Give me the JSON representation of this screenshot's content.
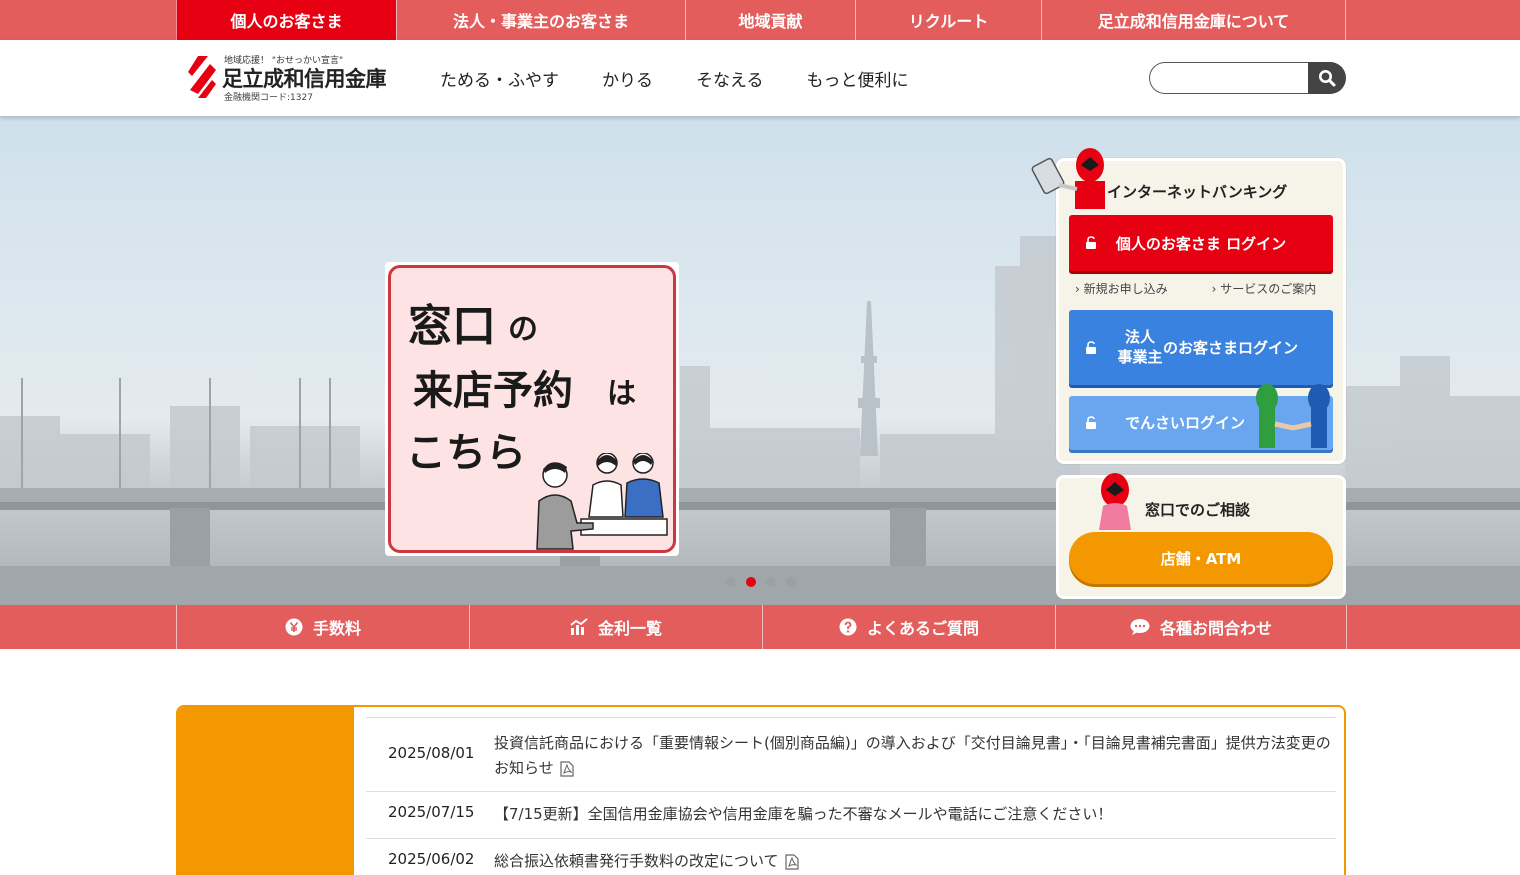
{
  "top_nav": {
    "items": [
      {
        "label": "個人のお客さま",
        "active": true
      },
      {
        "label": "法人・事業主のお客さま",
        "active": false
      },
      {
        "label": "地域貢献",
        "active": false
      },
      {
        "label": "リクルート",
        "active": false
      },
      {
        "label": "足立成和信用金庫について",
        "active": false
      }
    ]
  },
  "header": {
    "logo_tagline": "地域応援！ \"おせっかい宣言\"",
    "logo_name": "足立成和信用金庫",
    "logo_code": "金融機関コード:1327",
    "nav": [
      "ためる・ふやす",
      "かりる",
      "そなえる",
      "もっと便利に"
    ],
    "search": {
      "placeholder": "",
      "value": "",
      "icon": "search-icon"
    }
  },
  "hero": {
    "banner": {
      "line1_big": "窓口",
      "line1_small": "の",
      "line2_big": "来店予約",
      "line2_small": "は",
      "line3": "こちら"
    },
    "slides_total": 4,
    "active_slide": 2
  },
  "internet_banking": {
    "title": "インターネットバンキング",
    "personal_login": "個人のお客さま ログイン",
    "links": [
      "新規お申し込み",
      "サービスのご案内"
    ],
    "corporate_line1": "法人",
    "corporate_line2": "事業主",
    "corporate_suffix": "のお客さまログイン",
    "densai_login": "でんさいログイン"
  },
  "consult": {
    "title": "窓口でのご相談",
    "button": "店舗・ATM"
  },
  "quick_links": [
    {
      "label": "手数料",
      "icon": "yen-icon"
    },
    {
      "label": "金利一覧",
      "icon": "chart-icon"
    },
    {
      "label": "よくあるご質問",
      "icon": "question-icon"
    },
    {
      "label": "各種お問合わせ",
      "icon": "chat-icon"
    }
  ],
  "news": [
    {
      "date": "2025/08/01",
      "title": "投資信託商品における「重要情報シート(個別商品編)」の導入および「交付目論見書」・「目論見書補完書面」提供方法変更のお知らせ",
      "pdf": true
    },
    {
      "date": "2025/07/15",
      "title": "【7/15更新】全国信用金庫協会や信用金庫を騙った不審なメールや電話にご注意ください！",
      "pdf": false
    },
    {
      "date": "2025/06/02",
      "title": "総合振込依頼書発行手数料の改定について",
      "pdf": true
    }
  ],
  "colors": {
    "brand_red": "#e60012",
    "nav_coral": "#e45d5d",
    "corporate_blue": "#3a82e0",
    "densai_blue": "#69a6ef",
    "accent_orange": "#f39800"
  }
}
